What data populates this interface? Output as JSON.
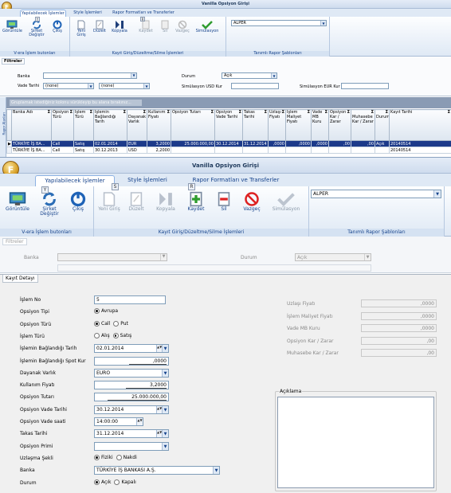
{
  "window_title": "Vanilla Opsiyon Girişi",
  "app_button_label": "F",
  "ribbon": {
    "tabs": [
      "Yapılabilecek İşlemler",
      "Style İşlemleri",
      "Rapor Formatları ve Transferler"
    ],
    "keytips": {
      "tab2": "S",
      "tab3": "R",
      "btn_sirket": "Y",
      "btn_kaydet": "R"
    },
    "group1": {
      "label": "V-era İşlem butonları",
      "buttons": [
        "Görüntüle",
        "Şirket Değiştir",
        "Çıkış"
      ]
    },
    "group2": {
      "label": "Kayıt Giriş/Düzeltme/Silme İşlemleri",
      "buttons": [
        "Yeni Giriş",
        "Düzelt",
        "Kopyala",
        "Kaydet",
        "Sil",
        "Vazgeç",
        "Simülasyon"
      ]
    },
    "group3": {
      "label": "Tanımlı Rapor Şablonları",
      "combo_value": "ALPER"
    }
  },
  "filters": {
    "tab": "Filtreler",
    "banka_label": "Banka",
    "durum_label": "Durum",
    "durum_value": "Açık",
    "vade_label": "Vade Tarihi",
    "vade_from": "(none)",
    "vade_to": "(none)",
    "sim_usd_label": "Simülasyon USD Kur",
    "sim_eur_label": "Simülasyon EUR Kur",
    "side_tab": "Rapor Alanları",
    "group_hint": "Gruplamak istediğiniz kolonu sürükleyip bu alana bırakınız..."
  },
  "grid": {
    "columns": [
      "Banka Adı",
      "Opsiyon Türü",
      "İşlem Türü",
      "İşlemin Bağlandığı Tarih",
      "Dayanak Varlık",
      "Kullanım Fiyatı",
      "Opsiyon Tutarı",
      "Opsiyon Vade Tarihi",
      "Takas Tarihi",
      "Uzlaşı Fiyatı",
      "İşlem Maliyet Fiyatı",
      "Vade MB Kuru",
      "Opsiyon Kar / Zarar",
      "Muhasebe Kar / Zarar",
      "Durum",
      "Kayıt Tarihi"
    ],
    "rows": [
      [
        "TÜRKİYE İŞ BA...",
        "Call",
        "Satış",
        "02.01.2014",
        "EUR",
        "3,2000",
        "25.000.000,00",
        "30.12.2014",
        "31.12.2014",
        ",0000",
        ",0000",
        ",0000",
        ",00",
        ",00",
        "Açık",
        "20140514"
      ],
      [
        "TÜRKİYE İŞ BA...",
        "Call",
        "Satış",
        "30.12.2013",
        "USD",
        "2,2000",
        "",
        "",
        "",
        "",
        "",
        "",
        "",
        "",
        "",
        "20140514"
      ]
    ]
  },
  "lower_filters": {
    "tab": "Filtreler",
    "banka_label": "Banka",
    "durum_label": "Durum",
    "durum_value": "Açık"
  },
  "detail": {
    "tab": "Kayıt Detayı",
    "fields": {
      "islem_no": {
        "label": "İşlem No",
        "value": "5"
      },
      "opsiyon_tipi": {
        "label": "Opsiyon Tipi",
        "options": [
          "Avrupa"
        ],
        "selected": "Avrupa"
      },
      "opsiyon_turu": {
        "label": "Opsiyon Türü",
        "options": [
          "Call",
          "Put"
        ],
        "selected": "Call"
      },
      "islem_turu": {
        "label": "İşlem Türü",
        "options": [
          "Alış",
          "Satış"
        ],
        "selected": "Satış"
      },
      "baglandigi_tarih": {
        "label": "İşlemin Bağlandığı Tarih",
        "value": "02.01.2014"
      },
      "spot_kur": {
        "label": "İşlemin Bağlandığı Spot Kur",
        "value": ",0000"
      },
      "dayanak_varlik": {
        "label": "Dayanak Varlık",
        "value": "EURO"
      },
      "kullanim_fiyati": {
        "label": "Kullanım Fiyatı",
        "value": "3,2000"
      },
      "opsiyon_tutari": {
        "label": "Opsiyon Tutarı",
        "value": "25.000.000,00"
      },
      "vade_tarihi": {
        "label": "Opsiyon Vade Tarihi",
        "value": "30.12.2014"
      },
      "vade_saati": {
        "label": "Opsiyon Vade saati",
        "value": "14:00:00"
      },
      "takas_tarihi": {
        "label": "Takas Tarihi",
        "value": "31.12.2014"
      },
      "opsiyon_primi": {
        "label": "Opsiyon Primi",
        "value": ""
      },
      "uzlasma_sekli": {
        "label": "Uzlaşma Şekli",
        "options": [
          "Fiziki",
          "Nakdi"
        ],
        "selected": "Fiziki"
      },
      "banka": {
        "label": "Banka",
        "value": "TÜRKİYE İŞ BANKASI A.Ş."
      },
      "durum": {
        "label": "Durum",
        "options": [
          "Açık",
          "Kapalı"
        ],
        "selected": "Açık"
      }
    },
    "right_fields": [
      {
        "label": "Uzlaşı Fiyatı",
        "value": ",0000"
      },
      {
        "label": "İşlem Maliyet Fiyatı",
        "value": ",0000"
      },
      {
        "label": "Vade MB Kuru",
        "value": ",0000"
      },
      {
        "label": "Opsiyon Kar / Zarar",
        "value": ",00"
      },
      {
        "label": "Muhasebe Kar / Zarar",
        "value": ",00"
      }
    ],
    "aciklama_label": "Açıklama"
  }
}
